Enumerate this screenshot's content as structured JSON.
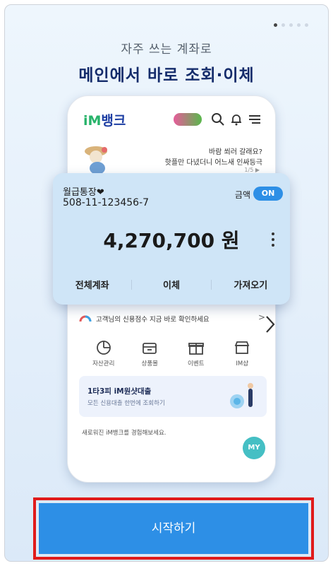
{
  "pager": {
    "count": 5,
    "active": 0
  },
  "hero": {
    "subtitle": "자주 쓰는 계좌로",
    "title": "메인에서 바로 조회·이체"
  },
  "app": {
    "logo_prefix": "iM",
    "logo_suffix": "뱅크",
    "header_icons": [
      "search-icon",
      "bell-icon",
      "menu-icon"
    ]
  },
  "promo": {
    "line1": "바람 쐬러 갈래요?",
    "line2": "핫플만 다녔더니 어느새 인싸등극",
    "page": "1/5 ▶"
  },
  "account": {
    "name": "월급통장❤",
    "number": "508-11-123456-7",
    "amount_label": "금액",
    "toggle": "ON",
    "balance": "4,270,700 원",
    "actions": [
      "전체계좌",
      "이체",
      "가져오기"
    ]
  },
  "credit": {
    "text": "고객님의 신용점수 지금 바로 확인하세요",
    "arrow": ">"
  },
  "quick_menu": [
    {
      "label": "자산관리",
      "icon": "pie-chart-icon"
    },
    {
      "label": "상품몰",
      "icon": "store-icon"
    },
    {
      "label": "이벤트",
      "icon": "gift-icon"
    },
    {
      "label": "IM샵",
      "icon": "shop-icon"
    }
  ],
  "loan": {
    "title": "1타3피 iM원샷대출",
    "subtitle": "모든 신용대출 한번에 조회하기"
  },
  "notice": "새로워진 iM뱅크를 경험해보세요.",
  "my_button": "MY",
  "start_button": "시작하기",
  "colors": {
    "brand_blue": "#2d8fe6",
    "navy": "#152c6b",
    "highlight_red": "#e01b1b",
    "card_bg": "#cfe5f7"
  }
}
